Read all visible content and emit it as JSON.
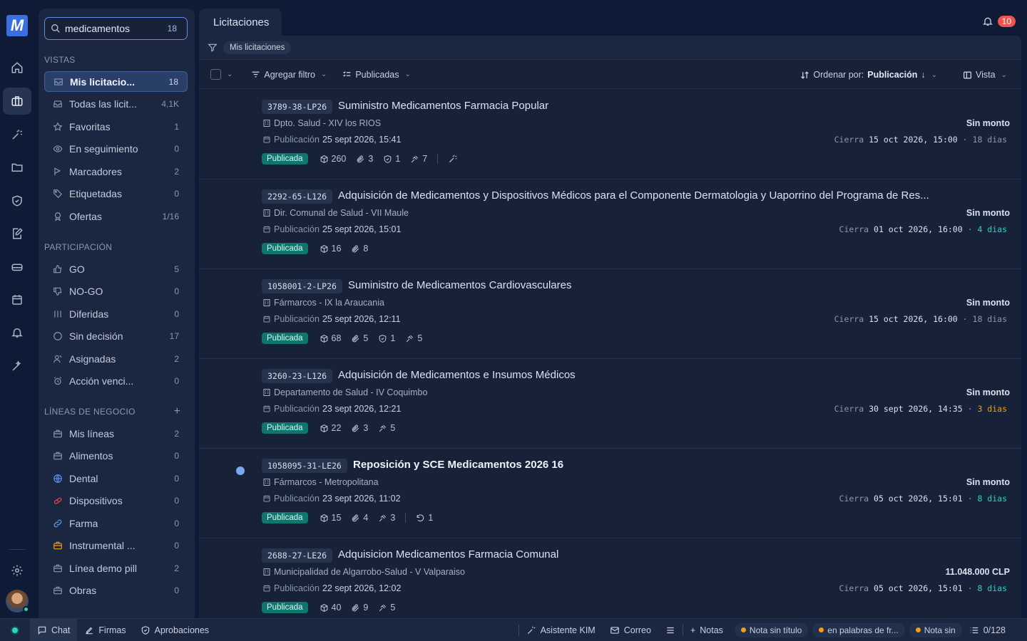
{
  "app": {
    "logo_letter": "M"
  },
  "search": {
    "value": "medicamentos",
    "count": "18"
  },
  "sidebar": {
    "vistas_header": "VISTAS",
    "vistas": [
      {
        "label": "Mis licitacio...",
        "count": "18",
        "icon": "inbox-icon"
      },
      {
        "label": "Todas las licit...",
        "count": "4,1K",
        "icon": "mailbox-icon"
      },
      {
        "label": "Favoritas",
        "count": "1",
        "icon": "star-icon"
      },
      {
        "label": "En seguimiento",
        "count": "0",
        "icon": "eye-icon"
      },
      {
        "label": "Marcadores",
        "count": "2",
        "icon": "flag-icon"
      },
      {
        "label": "Etiquetadas",
        "count": "0",
        "icon": "tag-icon"
      },
      {
        "label": "Ofertas",
        "count": "1/16",
        "icon": "award-icon"
      }
    ],
    "participacion_header": "PARTICIPACIÓN",
    "participacion": [
      {
        "label": "GO",
        "count": "5",
        "icon": "thumbs-up-icon"
      },
      {
        "label": "NO-GO",
        "count": "0",
        "icon": "thumbs-down-icon"
      },
      {
        "label": "Diferidas",
        "count": "0",
        "icon": "columns-icon"
      },
      {
        "label": "Sin decisión",
        "count": "17",
        "icon": "circle-icon"
      },
      {
        "label": "Asignadas",
        "count": "2",
        "icon": "user-icon"
      },
      {
        "label": "Acción venci...",
        "count": "0",
        "icon": "alarm-icon"
      }
    ],
    "lineas_header": "LÍNEAS DE NEGOCIO",
    "lineas": [
      {
        "label": "Mis líneas",
        "count": "2",
        "icon": "briefcase-icon",
        "color": "#8a97b0"
      },
      {
        "label": "Alimentos",
        "count": "0",
        "icon": "briefcase-icon",
        "color": "#8a97b0"
      },
      {
        "label": "Dental",
        "count": "0",
        "icon": "globe-icon",
        "color": "#5b8def"
      },
      {
        "label": "Dispositivos",
        "count": "0",
        "icon": "pills-icon",
        "color": "#ef4444"
      },
      {
        "label": "Farma",
        "count": "0",
        "icon": "link-icon",
        "color": "#60a5fa"
      },
      {
        "label": "Instrumental ...",
        "count": "0",
        "icon": "briefcase-icon",
        "color": "#f59e0b"
      },
      {
        "label": "Línea demo pill",
        "count": "2",
        "icon": "briefcase-icon",
        "color": "#8a97b0"
      },
      {
        "label": "Obras",
        "count": "0",
        "icon": "briefcase-icon",
        "color": "#8a97b0"
      }
    ]
  },
  "main": {
    "tab_label": "Licitaciones",
    "notif_count": "10",
    "filter_chip": "Mis licitaciones",
    "toolbar": {
      "add_filter": "Agregar filtro",
      "status": "Publicadas",
      "sort_label": "Ordenar por:",
      "sort_value": "Publicación",
      "view": "Vista"
    },
    "rows": [
      {
        "id": "3789-38-LP26",
        "title": "Suministro Medicamentos Farmacia Popular",
        "unread": false,
        "org": "Dpto. Salud - XIV los RIOS",
        "pub_label": "Publicación",
        "pub_date": "25 sept 2026, 15:41",
        "amount": "Sin monto",
        "closes_label": "Cierra",
        "closes_date": "15 oct 2026, 15:00",
        "days": "18 dias",
        "days_tone": "gray",
        "status": "Publicada",
        "items": "260",
        "attachments": "3",
        "checks": "1",
        "bids": "7",
        "redo": "",
        "ai": true
      },
      {
        "id": "2292-65-L126",
        "title": "Adquisición de Medicamentos y Dispositivos Médicos para el Componente Dermatologia y Uaporrino del Programa de Res...",
        "unread": false,
        "org": "Dir. Comunal de Salud - VII Maule",
        "pub_label": "Publicación",
        "pub_date": "25 sept 2026, 15:01",
        "amount": "Sin monto",
        "closes_label": "Cierra",
        "closes_date": "01 oct 2026, 16:00",
        "days": "4 dias",
        "days_tone": "teal",
        "status": "Publicada",
        "items": "16",
        "attachments": "8",
        "checks": "",
        "bids": "",
        "redo": "",
        "ai": false
      },
      {
        "id": "1058001-2-LP26",
        "title": "Suministro de Medicamentos Cardiovasculares",
        "unread": false,
        "org": "Fármarcos - IX la Araucania",
        "pub_label": "Publicación",
        "pub_date": "25 sept 2026, 12:11",
        "amount": "Sin monto",
        "closes_label": "Cierra",
        "closes_date": "15 oct 2026, 16:00",
        "days": "18 dias",
        "days_tone": "gray",
        "status": "Publicada",
        "items": "68",
        "attachments": "5",
        "checks": "1",
        "bids": "5",
        "redo": "",
        "ai": false
      },
      {
        "id": "3260-23-L126",
        "title": "Adquisición de Medicamentos e Insumos Médicos",
        "unread": false,
        "org": "Departamento de Salud - IV Coquimbo",
        "pub_label": "Publicación",
        "pub_date": "23 sept 2026, 12:21",
        "amount": "Sin monto",
        "closes_label": "Cierra",
        "closes_date": "30 sept 2026, 14:35",
        "days": "3 dias",
        "days_tone": "orange",
        "status": "Publicada",
        "items": "22",
        "attachments": "3",
        "checks": "",
        "bids": "5",
        "redo": "",
        "ai": false
      },
      {
        "id": "1058095-31-LE26",
        "title": "Reposición y SCE Medicamentos 2026 16",
        "unread": true,
        "org": "Fármarcos - Metropolitana",
        "pub_label": "Publicación",
        "pub_date": "23 sept 2026, 11:02",
        "amount": "Sin monto",
        "closes_label": "Cierra",
        "closes_date": "05 oct 2026, 15:01",
        "days": "8 dias",
        "days_tone": "teal",
        "status": "Publicada",
        "items": "15",
        "attachments": "4",
        "checks": "",
        "bids": "3",
        "redo": "1",
        "ai": false
      },
      {
        "id": "2688-27-LE26",
        "title": "Adquisicion Medicamentos Farmacia Comunal",
        "unread": false,
        "org": "Municipalidad de Algarrobo-Salud - V Valparaiso",
        "pub_label": "Publicación",
        "pub_date": "22 sept 2026, 12:02",
        "amount": "11.048.000 CLP",
        "closes_label": "Cierra",
        "closes_date": "05 oct 2026, 15:01",
        "days": "8 dias",
        "days_tone": "teal",
        "status": "Publicada",
        "items": "40",
        "attachments": "9",
        "checks": "",
        "bids": "5",
        "redo": "",
        "ai": false
      }
    ]
  },
  "bottom": {
    "chat": "Chat",
    "firmas": "Firmas",
    "aprobaciones": "Aprobaciones",
    "asistente": "Asistente KIM",
    "correo": "Correo",
    "notas": "Notas",
    "notes": [
      "Nota sin título",
      "en palabras de fr...",
      "Nota sin"
    ],
    "counter": "0/128"
  }
}
